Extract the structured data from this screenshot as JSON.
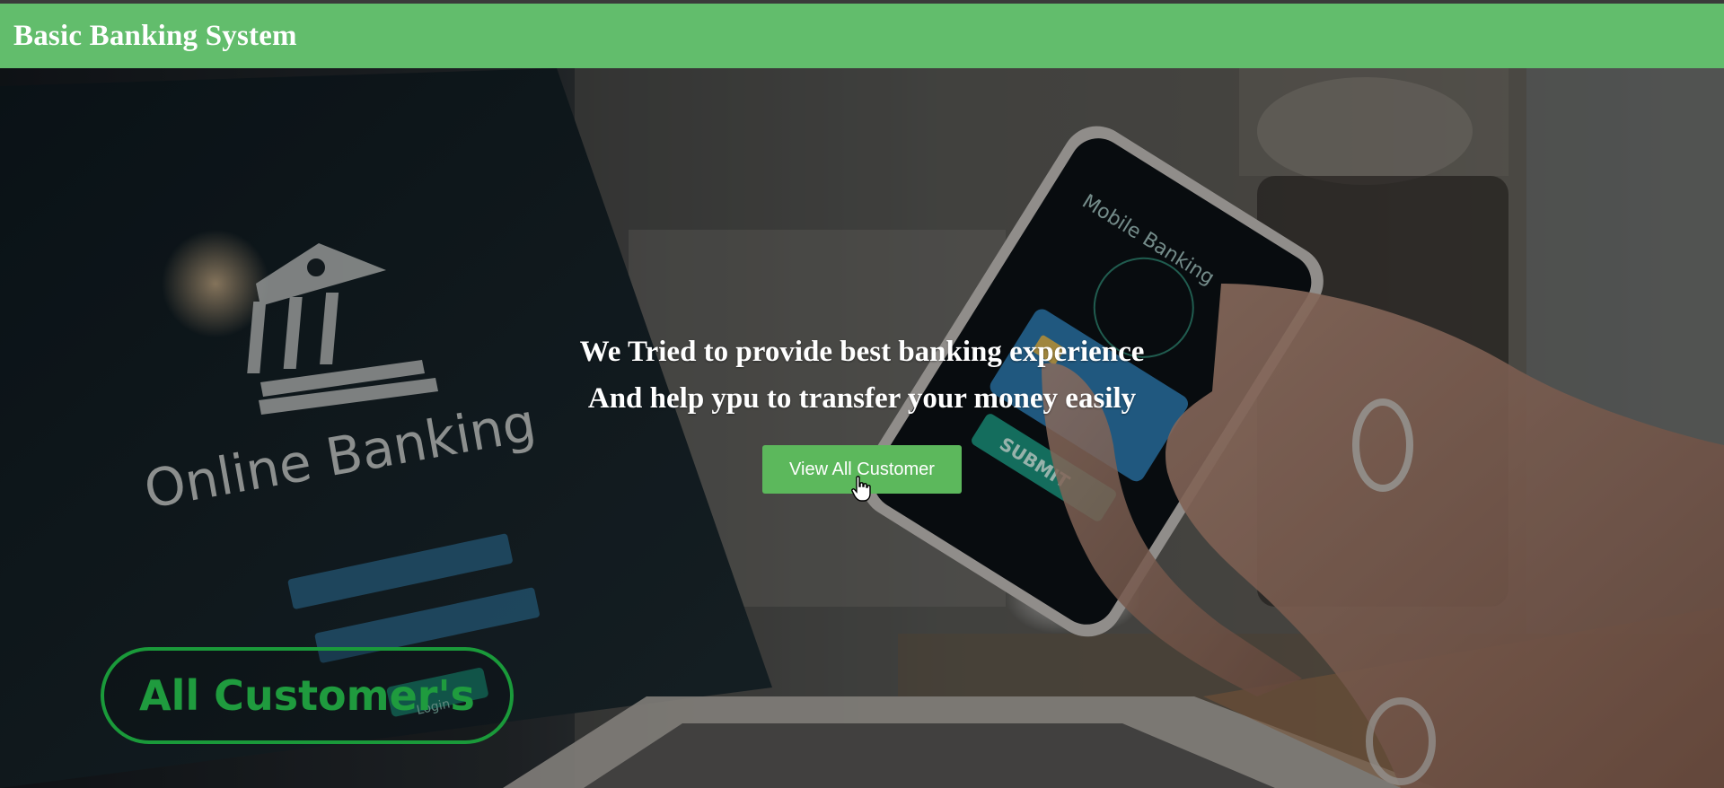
{
  "navbar": {
    "brand": "Basic Banking System",
    "color": "#62bd6c"
  },
  "hero": {
    "image_text": {
      "laptop_label": "Online Banking",
      "phone_label": "Mobile Banking",
      "phone_button": "SUBMIT",
      "login_button": "Login"
    },
    "tagline_line1": "We Tried to provide best banking experience",
    "tagline_line2": "And help ypu to transfer your money easily",
    "cta_label": "View All Customer",
    "cta_color": "#5cb85c",
    "badge_label": "All Customer's",
    "badge_color": "#1f9b3e"
  },
  "icons": [
    "bank-building-icon",
    "hand-pointer-cursor-icon"
  ]
}
